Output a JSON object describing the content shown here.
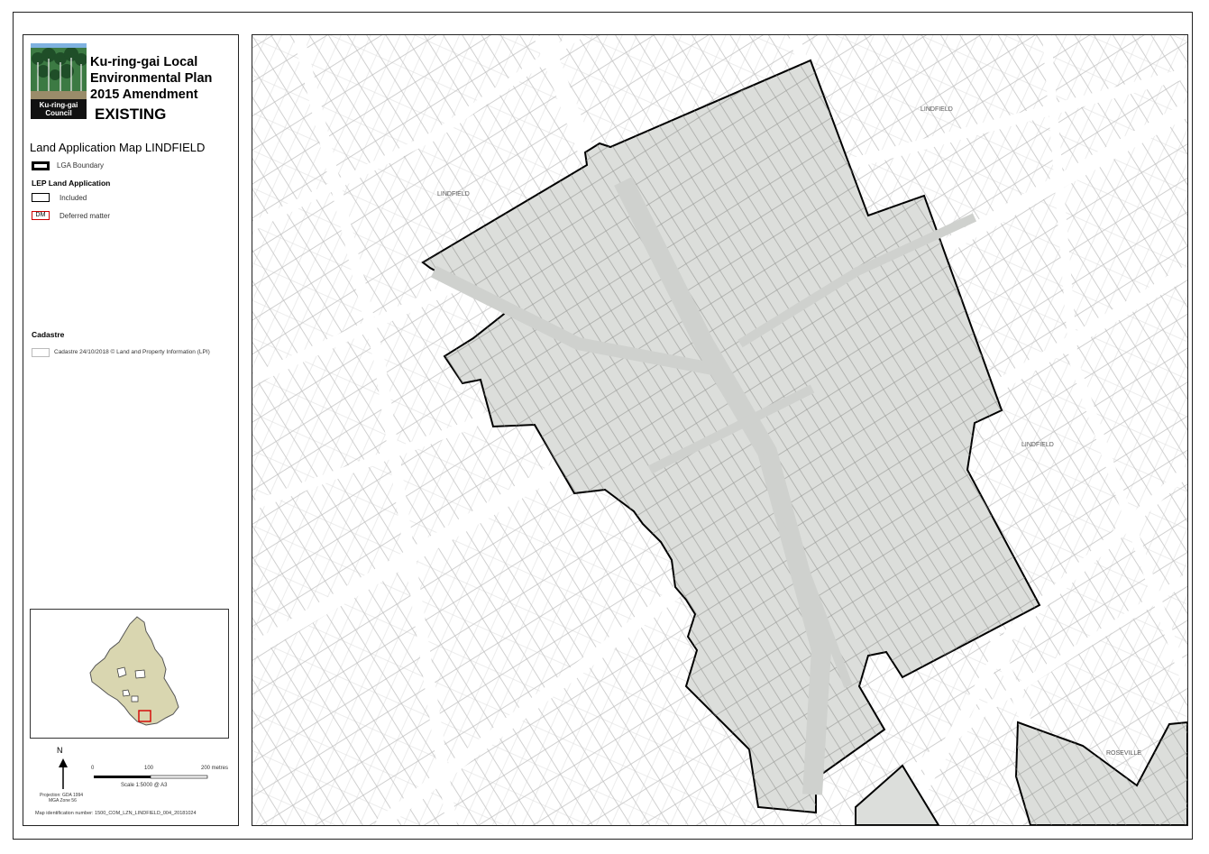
{
  "legend": {
    "plan_title": "Ku-ring-gai Local Environmental Plan 2015 Amendment",
    "status": "EXISTING",
    "logo_text": "Ku-ring-gai Council",
    "map_name": "Land Application Map LINDFIELD",
    "lga_boundary_label": "LGA Boundary",
    "lep_heading": "LEP Land Application",
    "included_label": "Included",
    "deferred_code": "DM",
    "deferred_label": "Deferred matter",
    "cadastre_heading": "Cadastre",
    "cadastre_label": "Cadastre 24/10/2018 © Land and Property Information (LPI)",
    "north_label": "N",
    "scale_ticks": [
      "0",
      "100",
      "200 metres"
    ],
    "scale_text": "Scale  1:5000  @ A3",
    "projection": "Projection: GDA 1994",
    "zone": "MGA Zone 56",
    "map_id": "Map identification number: 1500_COM_LZN_LINDFIELD_004_20181024"
  },
  "map": {
    "street_labels": [
      "LINDFIELD",
      "LINDFIELD",
      "LINDFIELD",
      "ROSEVILLE"
    ]
  },
  "colors": {
    "included_fill": "#dcdedb",
    "boundary_stroke": "#000000",
    "deferred_stroke": "#cc0000",
    "parcel_stroke": "#b8b8b8",
    "inset_fill": "#d9d6b0"
  }
}
